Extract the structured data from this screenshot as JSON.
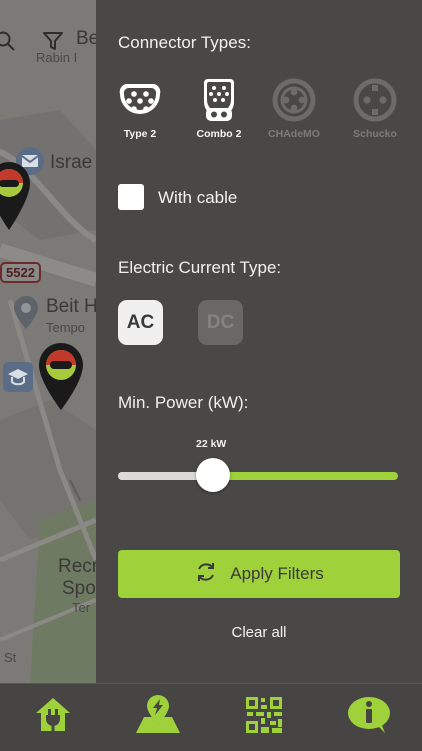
{
  "map": {
    "labels": [
      "Be",
      "Rabin I",
      "Israe",
      "Beit H",
      "Tempo",
      "Recr",
      "Spo",
      "Ter",
      "St"
    ],
    "road_number": "5522",
    "icons": [
      "search-icon",
      "filter-icon",
      "mail-icon",
      "place-icon",
      "school-icon",
      "ev-charger-pin-icon"
    ]
  },
  "filters": {
    "connector_title": "Connector Types:",
    "connectors": [
      {
        "label": "Type 2",
        "icon": "type2-connector-icon",
        "enabled": true
      },
      {
        "label": "Combo 2",
        "icon": "combo2-connector-icon",
        "enabled": true
      },
      {
        "label": "CHAdeMO",
        "icon": "chademo-connector-icon",
        "enabled": false
      },
      {
        "label": "Schucko",
        "icon": "schuko-connector-icon",
        "enabled": false
      }
    ],
    "with_cable_label": "With cable",
    "with_cable_checked": false,
    "current_title": "Electric Current Type:",
    "current_options": [
      {
        "label": "AC",
        "active": true
      },
      {
        "label": "DC",
        "active": false
      }
    ],
    "power_title": "Min. Power (kW):",
    "power_value_label": "22 kW",
    "power_value": 22,
    "apply_label": "Apply Filters",
    "clear_label": "Clear all"
  },
  "nav": {
    "items": [
      {
        "name": "home",
        "icon": "home-plug-icon"
      },
      {
        "name": "map",
        "icon": "map-charging-icon"
      },
      {
        "name": "qr",
        "icon": "qr-code-icon"
      },
      {
        "name": "info",
        "icon": "info-bubble-icon"
      }
    ]
  },
  "colors": {
    "accent": "#9ed13a",
    "panel_bg": "#4a4846",
    "text": "#f2f2f2",
    "disabled": "#7d7b79"
  }
}
